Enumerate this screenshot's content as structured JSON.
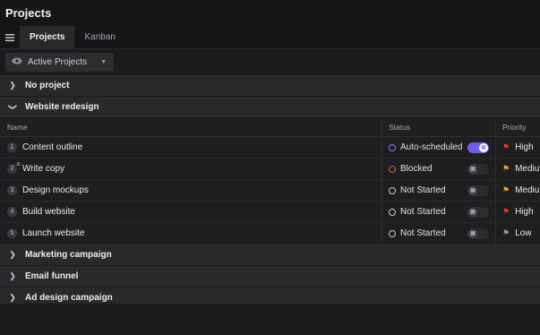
{
  "window": {
    "title": "Projects"
  },
  "tabs": [
    {
      "label": "Projects",
      "active": true
    },
    {
      "label": "Kanban",
      "active": false
    }
  ],
  "filter": {
    "label": "Active Projects",
    "icon": "eye-icon"
  },
  "groups_before": [
    {
      "label": "No project",
      "expanded": false
    },
    {
      "label": "Website redesign",
      "expanded": true
    }
  ],
  "table": {
    "columns": {
      "name": "Name",
      "status": "Status",
      "priority": "Priority"
    },
    "rows": [
      {
        "num": "1",
        "name": "Content outline",
        "status": "Auto-scheduled",
        "status_color": "#8b7cf6",
        "toggle_on": true,
        "priority": "High",
        "flag_color": "#e53935"
      },
      {
        "num": "2",
        "name": "Write copy",
        "status": "Blocked",
        "status_color": "#e5534b",
        "toggle_on": false,
        "priority": "Medium",
        "flag_color": "#f4a72a"
      },
      {
        "num": "3",
        "name": "Design mockups",
        "status": "Not Started",
        "status_color": "#c9c9ce",
        "toggle_on": false,
        "priority": "Medium",
        "flag_color": "#f4a72a"
      },
      {
        "num": "4",
        "name": "Build website",
        "status": "Not Started",
        "status_color": "#c9c9ce",
        "toggle_on": false,
        "priority": "High",
        "flag_color": "#e53935"
      },
      {
        "num": "5",
        "name": "Launch website",
        "status": "Not Started",
        "status_color": "#c9c9ce",
        "toggle_on": false,
        "priority": "Low",
        "flag_color": "#9a9aa0"
      }
    ]
  },
  "groups_after": [
    {
      "label": "Marketing campaign",
      "expanded": false
    },
    {
      "label": "Email funnel",
      "expanded": false
    },
    {
      "label": "Ad design campaign",
      "expanded": false
    }
  ]
}
